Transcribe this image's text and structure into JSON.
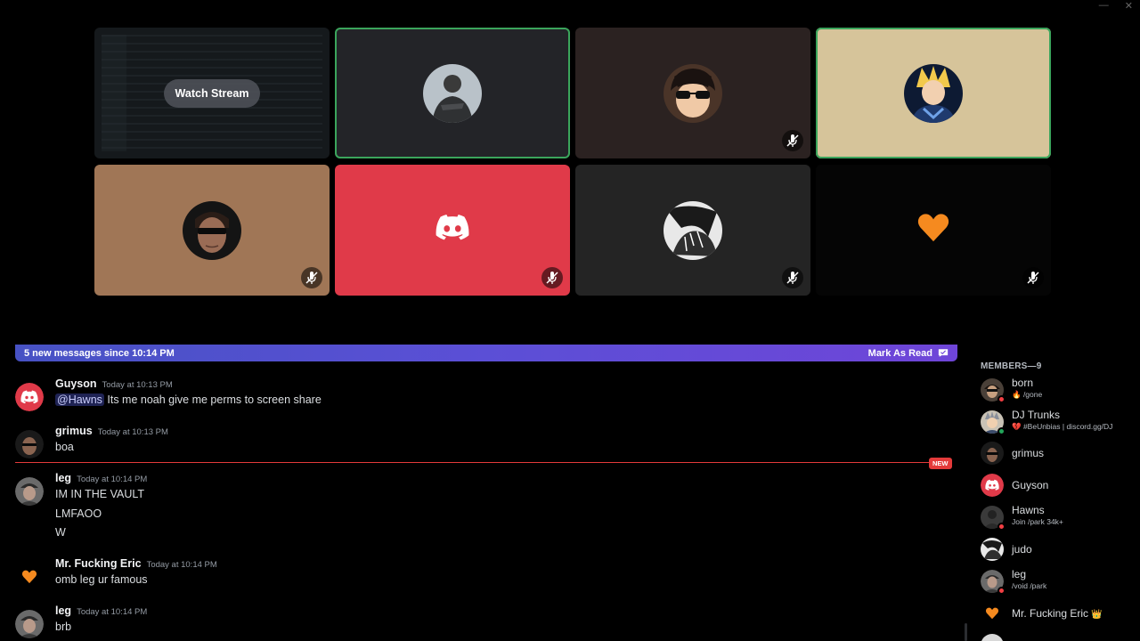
{
  "window": {
    "minimize": "—",
    "close": "✕"
  },
  "tiles": [
    {
      "type": "stream",
      "button": "Watch Stream",
      "bg": "#15191c"
    },
    {
      "type": "user",
      "bg": "#232428",
      "speaking": true,
      "muted": false,
      "avatar": "person-avatar"
    },
    {
      "type": "user",
      "bg": "#2b2221",
      "speaking": false,
      "muted": true,
      "avatar": "anime-avatar"
    },
    {
      "type": "user",
      "bg": "#d6c49a",
      "speaking": true,
      "muted": false,
      "avatar": "anime-hero-avatar"
    },
    {
      "type": "user",
      "bg": "#a07656",
      "speaking": false,
      "muted": true,
      "avatar": "sunglasses-avatar"
    },
    {
      "type": "user",
      "bg": "#e03a49",
      "speaking": false,
      "muted": true,
      "avatar": "discord-logo"
    },
    {
      "type": "user",
      "bg": "#242424",
      "speaking": false,
      "muted": true,
      "avatar": "manga-avatar"
    },
    {
      "type": "user",
      "bg": "#050505",
      "speaking": false,
      "muted": true,
      "avatar": "heart-avatar"
    }
  ],
  "banner": {
    "text": "5 new messages since 10:14 PM",
    "action": "Mark As Read"
  },
  "messages": [
    {
      "author": "Guyson",
      "time": "Today at 10:13 PM",
      "mention": "@Hawns",
      "lines": [
        "Its me noah give me perms to screen share"
      ]
    },
    {
      "author": "grimus",
      "time": "Today at 10:13 PM",
      "lines": [
        "boa"
      ]
    },
    {
      "author": "leg",
      "time": "Today at 10:14 PM",
      "lines": [
        "IM IN THE VAULT",
        "LMFAOO",
        "W"
      ]
    },
    {
      "author": "Mr. Fucking Eric",
      "time": "Today at 10:14 PM",
      "lines": [
        "omb leg ur famous"
      ]
    },
    {
      "author": "leg",
      "time": "Today at 10:14 PM",
      "lines": [
        "brb"
      ]
    }
  ],
  "new_tag": "NEW",
  "members": {
    "title": "MEMBERS—9",
    "list": [
      {
        "name": "born",
        "status": "🔥 /gone",
        "dot": "#f23f43"
      },
      {
        "name": "DJ Trunks",
        "status": "💔 #BeUnbias | discord.gg/DJ",
        "dot": "#23a55a"
      },
      {
        "name": "grimus",
        "status": "",
        "dot": ""
      },
      {
        "name": "Guyson",
        "status": "",
        "dot": ""
      },
      {
        "name": "Hawns",
        "status": "Join /park 34k+",
        "dot": "#f23f43"
      },
      {
        "name": "judo",
        "status": "",
        "dot": ""
      },
      {
        "name": "leg",
        "status": "/void /park",
        "dot": "#f23f43"
      },
      {
        "name": "Mr. Fucking Eric",
        "status": "",
        "dot": "",
        "badge": "👑"
      }
    ]
  },
  "colors": {
    "speaking": "#3ba55c",
    "discord_red": "#e03a49",
    "blurple": "#5865f2",
    "new_red": "#e43a3a"
  }
}
